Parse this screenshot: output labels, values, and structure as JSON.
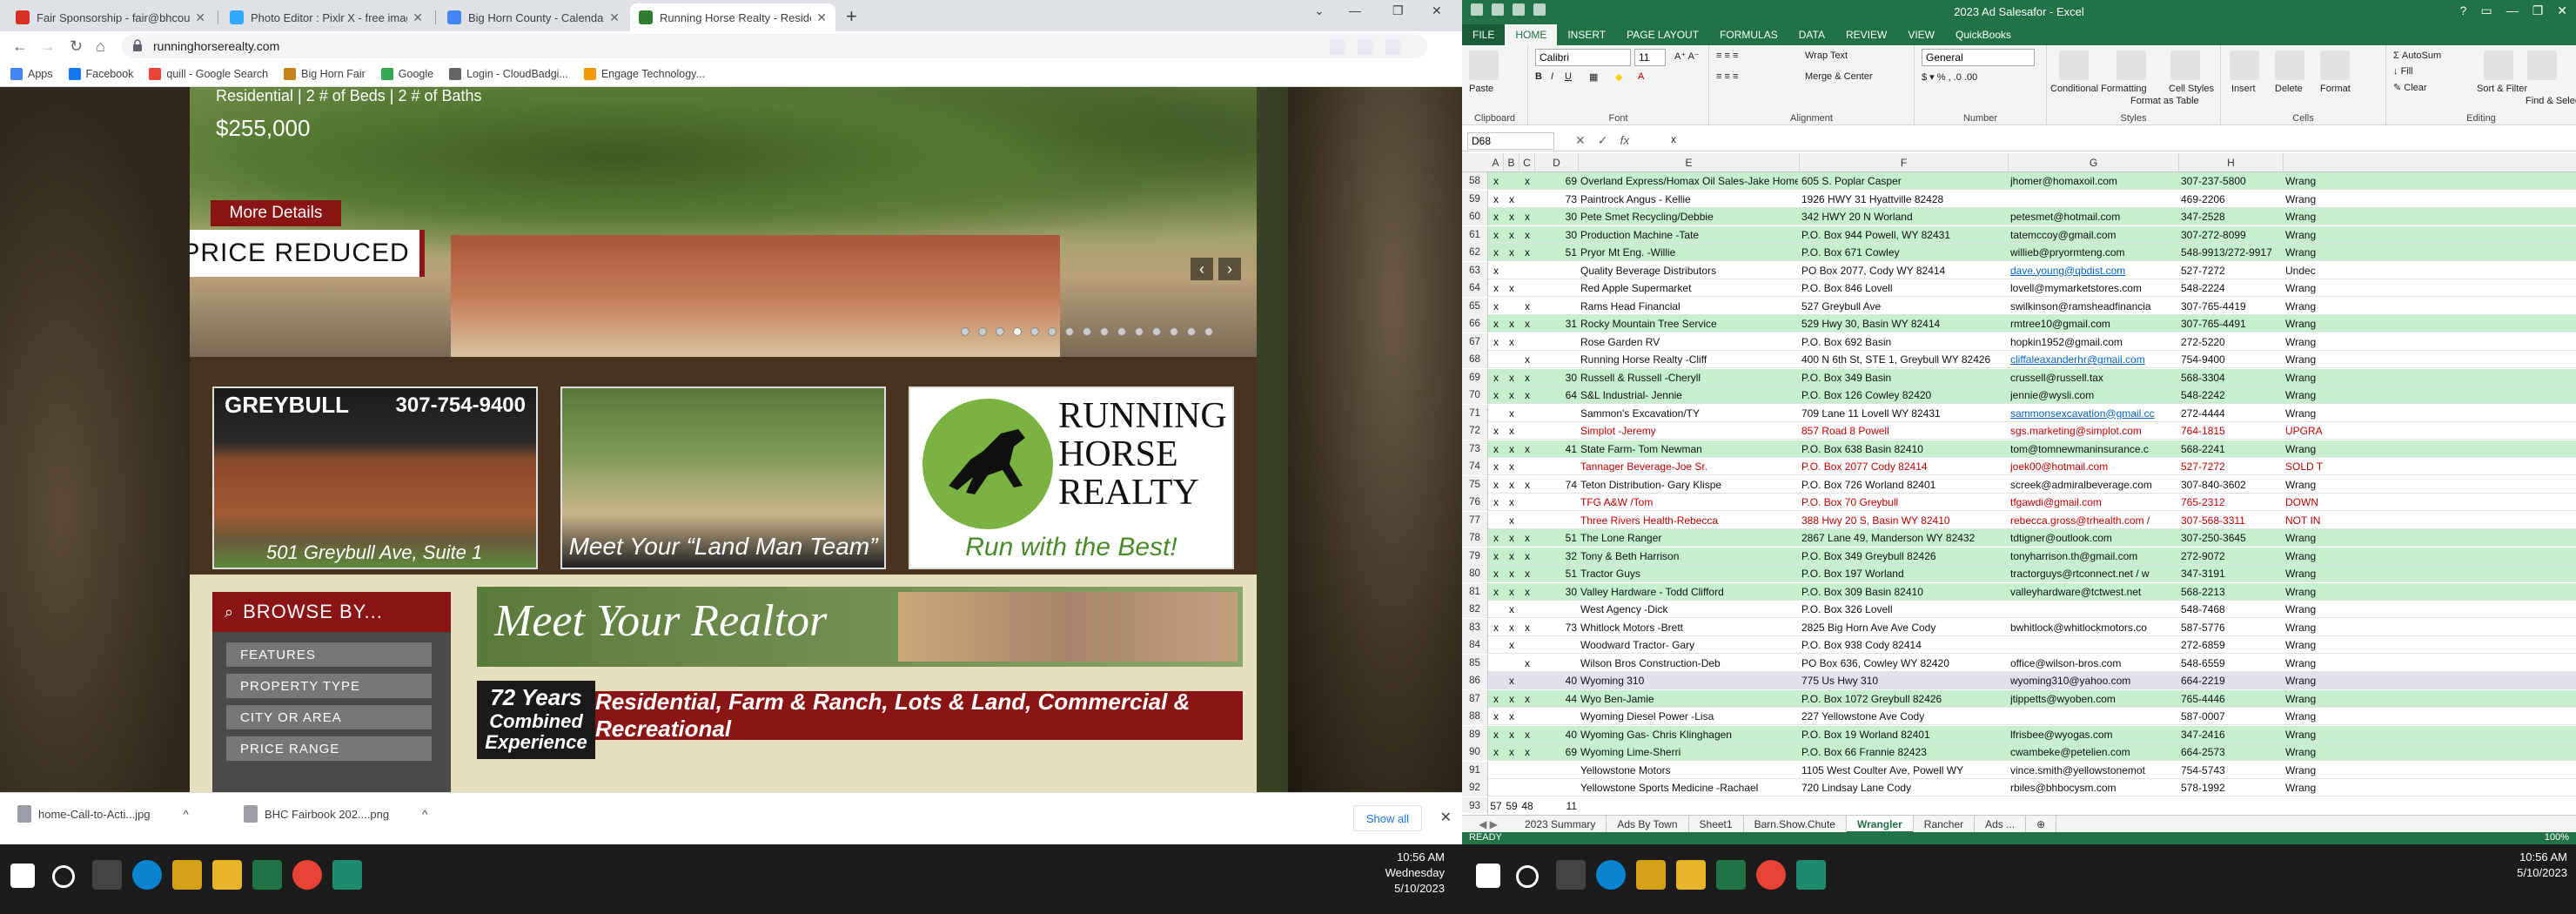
{
  "chrome": {
    "tabs": [
      {
        "label": "Fair Sponsorship - fair@bhcoun...",
        "color": "#d93025",
        "active": false
      },
      {
        "label": "Photo Editor : Pixlr X - free imag...",
        "color": "#31a8ff",
        "active": false
      },
      {
        "label": "Big Horn County - Calendar - Ju...",
        "color": "#4285f4",
        "active": false
      },
      {
        "label": "Running Horse Realty - Residen...",
        "color": "#2e7d32",
        "active": true
      }
    ],
    "url": "runninghorserealty.com",
    "bookmarks": [
      {
        "label": "Apps",
        "color": "#4285f4"
      },
      {
        "label": "Facebook",
        "color": "#1877f2"
      },
      {
        "label": "quill - Google Search",
        "color": "#ea4335"
      },
      {
        "label": "Big Horn Fair",
        "color": "#c9831e"
      },
      {
        "label": "Google",
        "color": "#34a853"
      },
      {
        "label": "Login - CloudBadgi...",
        "color": "#666666"
      },
      {
        "label": "Engage Technology...",
        "color": "#f29900"
      }
    ],
    "downloads": [
      {
        "label": "home-Call-to-Acti...jpg"
      },
      {
        "label": "BHC Fairbook 202....png"
      }
    ],
    "show_all": "Show all"
  },
  "site": {
    "hero_subtitle": "Residential | 2 # of Beds | 2 # of Baths",
    "hero_price": "$255,000",
    "more_details": "More Details",
    "price_reduced": "PRICE REDUCED",
    "tile1_city": "GREYBULL",
    "tile1_phone": "307-754-9400",
    "tile1_address": "501 Greybull Ave, Suite 1",
    "tile2_caption": "Meet Your “Land Man Team”",
    "tile3_line1": "RUNNING",
    "tile3_line2": "HORSE",
    "tile3_line3": "REALTY",
    "tile3_tagline": "Run with the Best!",
    "browse_title": "BROWSE BY...",
    "browse_items": [
      "FEATURES",
      "PROPERTY TYPE",
      "CITY OR AREA",
      "PRICE RANGE"
    ],
    "meet_title": "Meet Your Realtor",
    "years_a": "72 Years",
    "years_b": "Combined",
    "years_c": "Experience",
    "categories": "Residential, Farm & Ranch, Lots & Land, Commercial & Recreational"
  },
  "excel": {
    "title": "2023 Ad Salesafor - Excel",
    "ribbon_tabs": [
      "FILE",
      "HOME",
      "INSERT",
      "PAGE LAYOUT",
      "FORMULAS",
      "DATA",
      "REVIEW",
      "VIEW",
      "QuickBooks"
    ],
    "font": "Calibri",
    "font_size": "11",
    "number_format": "General",
    "groups": [
      "Clipboard",
      "Font",
      "Alignment",
      "Number",
      "Styles",
      "Cells",
      "Editing"
    ],
    "ribbon_labels": {
      "paste": "Paste",
      "wrap": "Wrap Text",
      "merge": "Merge & Center",
      "cond": "Conditional Formatting",
      "fmt_table": "Format as Table",
      "cell_styles": "Cell Styles",
      "insert": "Insert",
      "delete": "Delete",
      "format": "Format",
      "autosum": "AutoSum",
      "fill": "Fill",
      "clear": "Clear",
      "sort": "Sort & Filter",
      "find": "Find & Select"
    },
    "name_box": "D68",
    "formula": "x",
    "columns": [
      "A",
      "B",
      "C",
      "D",
      "E",
      "F",
      "G",
      "H"
    ],
    "rows": [
      {
        "n": "58",
        "a": "x",
        "b": "",
        "c": "x",
        "d": "69",
        "e": "Overland Express/Homax Oil Sales-Jake Homer",
        "f": "605 S. Poplar Casper",
        "g": "jhomer@homaxoil.com",
        "h": "307-237-5800",
        "i": "Wrang",
        "bg": "green",
        "red": false,
        "glink": false
      },
      {
        "n": "59",
        "a": "x",
        "b": "x",
        "c": "",
        "d": "73",
        "e": "Paintrock Angus - Kellie",
        "f": "1926 HWY 31 Hyattville 82428",
        "g": "",
        "h": "469-2206",
        "i": "Wrang",
        "bg": "",
        "red": false,
        "glink": false
      },
      {
        "n": "60",
        "a": "x",
        "b": "x",
        "c": "x",
        "d": "30",
        "e": "Pete Smet Recycling/Debbie",
        "f": "342 HWY 20 N Worland",
        "g": "petesmet@hotmail.com",
        "h": "347-2528",
        "i": "Wrang",
        "bg": "green",
        "red": false,
        "glink": false
      },
      {
        "n": "61",
        "a": "x",
        "b": "x",
        "c": "x",
        "d": "30",
        "e": "Production Machine -Tate",
        "f": "P.O. Box 944 Powell, WY 82431",
        "g": "tatemccoy@gmail.com",
        "h": "307-272-8099",
        "i": "Wrang",
        "bg": "green",
        "red": false,
        "glink": false
      },
      {
        "n": "62",
        "a": "x",
        "b": "x",
        "c": "x",
        "d": "51",
        "e": "Pryor Mt Eng. -Willie",
        "f": "P.O. Box 671 Cowley",
        "g": "willieb@pryormteng.com",
        "h": "548-9913/272-9917",
        "i": "Wrang",
        "bg": "green",
        "red": false,
        "glink": false
      },
      {
        "n": "63",
        "a": "x",
        "b": "",
        "c": "",
        "d": "",
        "e": "Quality Beverage Distributors",
        "f": "PO Box 2077, Cody WY 82414",
        "g": "dave.young@qbdist.com",
        "h": "527-7272",
        "i": "Undec",
        "bg": "",
        "red": false,
        "glink": true
      },
      {
        "n": "64",
        "a": "x",
        "b": "x",
        "c": "",
        "d": "",
        "e": "Red Apple Supermarket",
        "f": "P.O. Box 846 Lovell",
        "g": "lovell@mymarketstores.com",
        "h": "548-2224",
        "i": "Wrang",
        "bg": "",
        "red": false,
        "glink": false
      },
      {
        "n": "65",
        "a": "x",
        "b": "",
        "c": "x",
        "d": "",
        "e": "Rams Head Financial",
        "f": "527 Greybull Ave",
        "g": "swilkinson@ramsheadfinancia",
        "h": "307-765-4419",
        "i": "Wrang",
        "bg": "",
        "red": false,
        "glink": false
      },
      {
        "n": "66",
        "a": "x",
        "b": "x",
        "c": "x",
        "d": "31",
        "e": "Rocky Mountain Tree Service",
        "f": "529 Hwy 30, Basin WY 82414",
        "g": "rmtree10@gmail.com",
        "h": "307-765-4491",
        "i": "Wrang",
        "bg": "green",
        "red": false,
        "glink": false
      },
      {
        "n": "67",
        "a": "x",
        "b": "x",
        "c": "",
        "d": "",
        "e": "Rose Garden RV",
        "f": "P.O. Box 692 Basin",
        "g": "hopkin1952@gmail.com",
        "h": "272-5220",
        "i": "Wrang",
        "bg": "",
        "red": false,
        "glink": false
      },
      {
        "n": "68",
        "a": "",
        "b": "",
        "c": "x",
        "d": "",
        "e": "Running Horse Realty -Cliff",
        "f": "400 N 6th St, STE 1, Greybull WY 82426",
        "g": "cliffaleaxanderhr@gmail.com",
        "h": "754-9400",
        "i": "Wrang",
        "bg": "",
        "red": false,
        "glink": true
      },
      {
        "n": "69",
        "a": "x",
        "b": "x",
        "c": "x",
        "d": "30",
        "e": "Russell & Russell -Cheryll",
        "f": "P.O. Box 349 Basin",
        "g": "crussell@russell.tax",
        "h": "568-3304",
        "i": "Wrang",
        "bg": "green",
        "red": false,
        "glink": false
      },
      {
        "n": "70",
        "a": "x",
        "b": "x",
        "c": "x",
        "d": "64",
        "e": "S&L Industrial- Jennie",
        "f": "P.O. Box 126 Cowley 82420",
        "g": "jennie@wysli.com",
        "h": "548-2242",
        "i": "Wrang",
        "bg": "green",
        "red": false,
        "glink": false
      },
      {
        "n": "71",
        "a": "",
        "b": "x",
        "c": "",
        "d": "",
        "e": "Sammon's Excavation/TY",
        "f": "709 Lane 11 Lovell WY 82431",
        "g": "sammonsexcavation@gmail.cc",
        "h": "272-4444",
        "i": "Wrang",
        "bg": "",
        "red": false,
        "glink": true
      },
      {
        "n": "72",
        "a": "x",
        "b": "x",
        "c": "",
        "d": "",
        "e": "Simplot -Jeremy",
        "f": "857 Road 8 Powell",
        "g": "sgs.marketing@simplot.com",
        "h": "764-1815",
        "i": "UPGRA",
        "bg": "",
        "red": true,
        "glink": false
      },
      {
        "n": "73",
        "a": "x",
        "b": "x",
        "c": "x",
        "d": "41",
        "e": "State Farm- Tom Newman",
        "f": "P.O. Box 638 Basin 82410",
        "g": "tom@tomnewmaninsurance.c",
        "h": "568-2241",
        "i": "Wrang",
        "bg": "green",
        "red": false,
        "glink": false
      },
      {
        "n": "74",
        "a": "x",
        "b": "x",
        "c": "",
        "d": "",
        "e": "Tannager Beverage-Joe Sr.",
        "f": "P.O. Box 2077 Cody 82414",
        "g": "joek00@hotmail.com",
        "h": "527-7272",
        "i": "SOLD T",
        "bg": "",
        "red": true,
        "glink": false
      },
      {
        "n": "75",
        "a": "x",
        "b": "x",
        "c": "x",
        "d": "74",
        "e": "Teton Distribution- Gary Klispe",
        "f": "P.O. Box 726  Worland 82401",
        "g": "screek@admiralbeverage.com",
        "h": "307-840-3602",
        "i": "Wrang",
        "bg": "",
        "red": false,
        "glink": false
      },
      {
        "n": "76",
        "a": "x",
        "b": "x",
        "c": "",
        "d": "",
        "e": "TFG A&W /Tom",
        "f": "P.O. Box 70 Greybull",
        "g": "tfgawdi@gmail.com",
        "h": "765-2312",
        "i": "DOWN",
        "bg": "",
        "red": true,
        "glink": false
      },
      {
        "n": "77",
        "a": "",
        "b": "x",
        "c": "",
        "d": "",
        "e": "Three Rivers Health-Rebecca",
        "f": "388 Hwy 20 S, Basin WY 82410",
        "g": "rebecca.gross@trhealth.com /",
        "h": "307-568-3311",
        "i": "NOT IN",
        "bg": "",
        "red": true,
        "glink": false
      },
      {
        "n": "78",
        "a": "x",
        "b": "x",
        "c": "x",
        "d": "51",
        "e": "The Lone Ranger",
        "f": "2867 Lane 49, Manderson WY 82432",
        "g": "tdtigner@outlook.com",
        "h": "307-250-3645",
        "i": "Wrang",
        "bg": "green",
        "red": false,
        "glink": false
      },
      {
        "n": "79",
        "a": "x",
        "b": "x",
        "c": "x",
        "d": "32",
        "e": "Tony & Beth Harrison",
        "f": "P.O. Box 349 Greybull 82426",
        "g": "tonyharrison.th@gmail.com",
        "h": "272-9072",
        "i": "Wrang",
        "bg": "green",
        "red": false,
        "glink": false
      },
      {
        "n": "80",
        "a": "x",
        "b": "x",
        "c": "x",
        "d": "51",
        "e": "Tractor Guys",
        "f": "P.O. Box 197 Worland",
        "g": "tractorguys@rtconnect.net / w",
        "h": "347-3191",
        "i": "Wrang",
        "bg": "green",
        "red": false,
        "glink": false
      },
      {
        "n": "81",
        "a": "x",
        "b": "x",
        "c": "x",
        "d": "30",
        "e": "Valley Hardware - Todd Clifford",
        "f": "P.O. Box 309 Basin 82410",
        "g": "valleyhardware@tctwest.net",
        "h": "568-2213",
        "i": "Wrang",
        "bg": "green",
        "red": false,
        "glink": false
      },
      {
        "n": "82",
        "a": "",
        "b": "x",
        "c": "",
        "d": "",
        "e": "West Agency -Dick",
        "f": "P.O. Box 326 Lovell",
        "g": "",
        "h": "548-7468",
        "i": "Wrang",
        "bg": "",
        "red": false,
        "glink": false
      },
      {
        "n": "83",
        "a": "x",
        "b": "x",
        "c": "x",
        "d": "73",
        "e": "Whitlock Motors -Brett",
        "f": "2825 Big Horn Ave Ave Cody",
        "g": "bwhitlock@whitlockmotors.co",
        "h": "587-5776",
        "i": "Wrang",
        "bg": "",
        "red": false,
        "glink": false
      },
      {
        "n": "84",
        "a": "",
        "b": "x",
        "c": "",
        "d": "",
        "e": "Woodward Tractor- Gary",
        "f": "P.O. Box 938 Cody 82414",
        "g": "",
        "h": "272-6859",
        "i": "Wrang",
        "bg": "",
        "red": false,
        "glink": false
      },
      {
        "n": "85",
        "a": "",
        "b": "",
        "c": "x",
        "d": "",
        "e": "Wilson Bros Construction-Deb",
        "f": "PO Box 636, Cowley WY 82420",
        "g": "office@wilson-bros.com",
        "h": "548-6559",
        "i": "Wrang",
        "bg": "",
        "red": false,
        "glink": false
      },
      {
        "n": "86",
        "a": "",
        "b": "x",
        "c": "",
        "d": "40",
        "e": "Wyoming 310",
        "f": "775 Us Hwy 310",
        "g": "wyoming310@yahoo.com",
        "h": "664-2219",
        "i": "Wrang",
        "bg": "purple",
        "red": false,
        "glink": false
      },
      {
        "n": "87",
        "a": "x",
        "b": "x",
        "c": "x",
        "d": "44",
        "e": "Wyo Ben-Jamie",
        "f": "P.O. Box 1072 Greybull 82426",
        "g": "jtippetts@wyoben.com",
        "h": "765-4446",
        "i": "Wrang",
        "bg": "green",
        "red": false,
        "glink": false
      },
      {
        "n": "88",
        "a": "x",
        "b": "x",
        "c": "",
        "d": "",
        "e": "Wyoming Diesel Power -Lisa",
        "f": "227 Yellowstone Ave Cody",
        "g": "",
        "h": "587-0007",
        "i": "Wrang",
        "bg": "",
        "red": false,
        "glink": false
      },
      {
        "n": "89",
        "a": "x",
        "b": "x",
        "c": "x",
        "d": "40",
        "e": "Wyoming Gas- Chris Klinghagen",
        "f": "P.O. Box 19 Worland 82401",
        "g": "lfrisbee@wyogas.com",
        "h": "347-2416",
        "i": "Wrang",
        "bg": "green",
        "red": false,
        "glink": false
      },
      {
        "n": "90",
        "a": "x",
        "b": "x",
        "c": "x",
        "d": "69",
        "e": "Wyoming Lime-Sherri",
        "f": "P.O. Box 66 Frannie 82423",
        "g": "cwambeke@petelien.com",
        "h": "664-2573",
        "i": "Wrang",
        "bg": "green",
        "red": false,
        "glink": false
      },
      {
        "n": "91",
        "a": "",
        "b": "",
        "c": "",
        "d": "",
        "e": "Yellowstone Motors",
        "f": "1105 West Coulter Ave, Powell WY",
        "g": "vince.smith@yellowstonemot",
        "h": "754-5743",
        "i": "Wrang",
        "bg": "",
        "red": false,
        "glink": false
      },
      {
        "n": "92",
        "a": "",
        "b": "",
        "c": "",
        "d": "",
        "e": "Yellowstone Sports Medicine -Rachael",
        "f": "720 Lindsay Lane Cody",
        "g": "rbiles@bhbocysm.com",
        "h": "578-1992",
        "i": "Wrang",
        "bg": "",
        "red": false,
        "glink": false
      },
      {
        "n": "93",
        "a": "57",
        "b": "59",
        "c": "48",
        "d": "11",
        "e": "",
        "f": "",
        "g": "",
        "h": "",
        "i": "",
        "bg": "",
        "red": false,
        "glink": false
      }
    ],
    "sheet_tabs": [
      "2023 Summary",
      "Ads By Town",
      "Sheet1",
      "Barn.Show.Chute",
      "Wrangler",
      "Rancher",
      "Ads ..."
    ],
    "active_sheet": "Wrangler",
    "status": "READY",
    "zoom": "100%"
  },
  "taskbar": {
    "time": "10:56 AM",
    "day": "Wednesday",
    "date": "5/10/2023"
  }
}
